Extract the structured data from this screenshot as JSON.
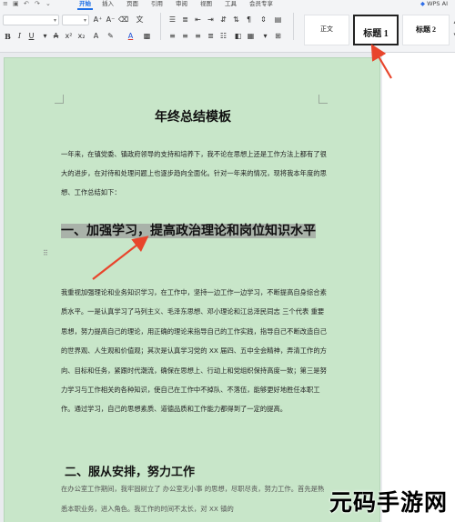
{
  "ribbon": {
    "tabs": [
      "开始",
      "插入",
      "页面",
      "引用",
      "审阅",
      "视图",
      "工具",
      "会员专享"
    ],
    "active_tab": "开始",
    "wps_ai_label": "WPS AI",
    "styles": {
      "normal": "正文",
      "heading1": "标题 1",
      "heading2": "标题 2"
    }
  },
  "document": {
    "title": "年终总结模板",
    "intro": "一年来，在镇党委、镇政府领导的支持和培养下，我不论在思想上还是工作方法上都有了很大的进步，在对待和处理问题上也逐步趋向全面化。针对一年来的情况，现将我本年度的思想、工作总结如下：",
    "heading1": "一、加强学习，提高政治理论和岗位知识水平",
    "section1": "我重视加强理论和业务知识学习，在工作中，坚持一边工作一边学习，不断提高自身综合素质水平。一是认真学习了马列主义、毛泽东思想、邓小理论和江总泽民同志 三个代表 重要思想，努力提高自己的理论，用正确的理论来指导自己的工作实践，指导自己不断改造自己的世界观、人生观和价值观；其次是认真学习党的 XX 届四、五中全会精神，弄清工作的方向、目标和任务，紧跟时代潮流，确保在思想上、行动上和党组织保持高度一致；第三是努力学习与工作相关的各种知识，使自己在工作中不掉队、不落伍，能够更好地胜任本职工作。通过学习，自己的思想素质、道德品质和工作能力都得到了一定的提高。",
    "heading2": "二、服从安排，努力工作",
    "section2": "在办公室工作期间，我牢固树立了 办公室无小事 的思想，尽职尽责，努力工作。首先是熟悉本职业务，进入角色。我工作的时间不太长，对 XX 镇的"
  },
  "watermark": {
    "text": "元码手游网"
  },
  "colors": {
    "accent": "#1e6fe6",
    "page_background": "#c8e6c9",
    "annotation_arrow": "#e8452c"
  }
}
